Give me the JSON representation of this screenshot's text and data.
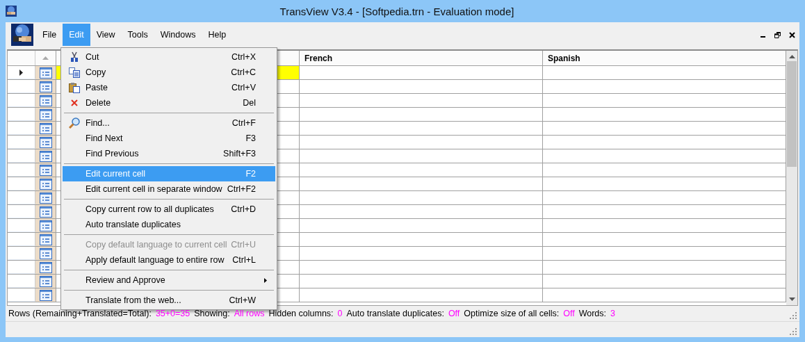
{
  "window": {
    "title": "TransView V3.4 - [Softpedia.trn - Evaluation mode]"
  },
  "menubar": [
    {
      "label": "File",
      "selected": false
    },
    {
      "label": "Edit",
      "selected": true
    },
    {
      "label": "View",
      "selected": false
    },
    {
      "label": "Tools",
      "selected": false
    },
    {
      "label": "Windows",
      "selected": false
    },
    {
      "label": "Help",
      "selected": false
    }
  ],
  "edit_menu": [
    {
      "kind": "item",
      "label": "Cut",
      "shortcut": "Ctrl+X",
      "disabled": false,
      "highlighted": false
    },
    {
      "kind": "item",
      "label": "Copy",
      "shortcut": "Ctrl+C",
      "disabled": false,
      "highlighted": false
    },
    {
      "kind": "item",
      "label": "Paste",
      "shortcut": "Ctrl+V",
      "disabled": false,
      "highlighted": false
    },
    {
      "kind": "item",
      "label": "Delete",
      "shortcut": "Del",
      "disabled": false,
      "highlighted": false
    },
    {
      "kind": "separator"
    },
    {
      "kind": "item",
      "label": "Find...",
      "shortcut": "Ctrl+F",
      "disabled": false,
      "highlighted": false
    },
    {
      "kind": "item",
      "label": "Find Next",
      "shortcut": "F3",
      "disabled": false,
      "highlighted": false
    },
    {
      "kind": "item",
      "label": "Find Previous",
      "shortcut": "Shift+F3",
      "disabled": false,
      "highlighted": false
    },
    {
      "kind": "separator"
    },
    {
      "kind": "item",
      "label": "Edit current cell",
      "shortcut": "F2",
      "disabled": false,
      "highlighted": true
    },
    {
      "kind": "item",
      "label": "Edit current cell in separate window",
      "shortcut": "Ctrl+F2",
      "disabled": false,
      "highlighted": false
    },
    {
      "kind": "separator"
    },
    {
      "kind": "item",
      "label": "Copy current row to all duplicates",
      "shortcut": "Ctrl+D",
      "disabled": false,
      "highlighted": false
    },
    {
      "kind": "item",
      "label": "Auto translate duplicates",
      "disabled": false,
      "highlighted": false
    },
    {
      "kind": "separator"
    },
    {
      "kind": "item",
      "label": "Copy default language to current cell",
      "shortcut": "Ctrl+U",
      "disabled": true,
      "highlighted": false
    },
    {
      "kind": "item",
      "label": "Apply default language to entire row",
      "shortcut": "Ctrl+L",
      "disabled": false,
      "highlighted": false
    },
    {
      "kind": "separator"
    },
    {
      "kind": "submenu",
      "label": "Review and Approve",
      "disabled": false,
      "highlighted": false
    },
    {
      "kind": "separator"
    },
    {
      "kind": "item",
      "label": "Translate from the web...",
      "shortcut": "Ctrl+W",
      "disabled": false,
      "highlighted": false
    }
  ],
  "grid": {
    "columns": [
      "French",
      "Spanish"
    ],
    "rows": [
      {
        "current": true
      },
      {
        "current": false
      },
      {
        "current": false
      },
      {
        "current": false
      },
      {
        "current": false
      },
      {
        "current": false
      },
      {
        "current": false
      },
      {
        "current": false
      },
      {
        "current": false
      },
      {
        "current": false
      },
      {
        "current": false
      },
      {
        "current": false
      },
      {
        "current": false
      },
      {
        "current": false
      },
      {
        "current": false
      },
      {
        "current": false
      },
      {
        "current": false
      }
    ]
  },
  "status_bar": [
    {
      "label": "Rows (Remaining+Translated=Total):",
      "value": "35+0=35"
    },
    {
      "label": "Showing:",
      "value": "All rows"
    },
    {
      "label": "Hidden columns:",
      "value": "0"
    },
    {
      "label": "Auto translate duplicates:",
      "value": "Off"
    },
    {
      "label": "Optimize size of all cells:",
      "value": "Off"
    },
    {
      "label": "Words:",
      "value": "3"
    }
  ]
}
